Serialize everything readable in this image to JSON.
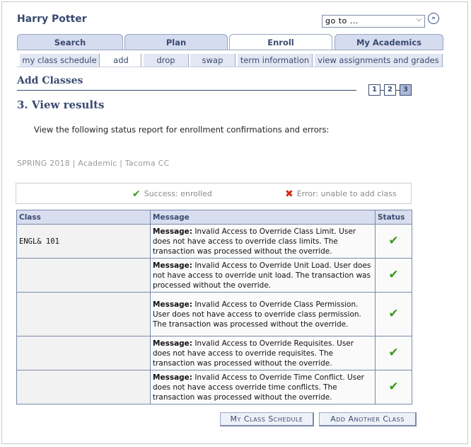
{
  "header": {
    "username": "Harry Potter",
    "goto_placeholder": "go to ...",
    "goto_arrow": "⌵",
    "go_button_icon": "»"
  },
  "tabs": [
    {
      "label": "Search"
    },
    {
      "label": "Plan"
    },
    {
      "label": "Enroll",
      "active": true
    },
    {
      "label": "My Academics"
    }
  ],
  "subtabs": [
    {
      "label": "my class schedule"
    },
    {
      "label": "add",
      "active": true
    },
    {
      "label": "drop"
    },
    {
      "label": "swap"
    },
    {
      "label": "term information"
    },
    {
      "label": "view assignments and grades"
    }
  ],
  "section": {
    "title": "Add Classes",
    "steps": [
      "1",
      "2",
      "3"
    ],
    "active_step": "3",
    "step_title": "3.  View results",
    "instructions": "View the following status report for enrollment confirmations and errors:",
    "term": "SPRING 2018 | Academic | Tacoma CC"
  },
  "legend": {
    "success_icon": "✔",
    "success_label": "Success: enrolled",
    "error_icon": "✖",
    "error_label": "Error: unable to add class"
  },
  "table": {
    "headers": {
      "class": "Class",
      "message": "Message",
      "status": "Status"
    },
    "rows": [
      {
        "class": "ENGL& 101",
        "prefix": "Message:",
        "message": " Invalid Access to Override Class Limit. User does not have access to override class limits. The transaction was processed without the override.",
        "status": "✔"
      },
      {
        "class": "",
        "prefix": "Message:",
        "message": " Invalid Access to Override Unit Load. User does not have access to override unit load. The transaction was processed without the override.",
        "status": "✔"
      },
      {
        "class": "",
        "prefix": "Message:",
        "message": " Invalid Access to Override Class Permission. User does not have access to override class permission. The transaction was processed without the override.",
        "status": "✔"
      },
      {
        "class": "",
        "prefix": "Message:",
        "message": " Invalid Access to Override Requisites. User does not have access to override requisites. The transaction was processed without the override.",
        "status": "✔"
      },
      {
        "class": "",
        "prefix": "Message:",
        "message": " Invalid Access to Override Time Conflict. User does not have access override time conflicts. The transaction was processed without the override.",
        "status": "✔"
      }
    ]
  },
  "buttons": {
    "my_schedule": "My Class Schedule",
    "add_another": "Add Another Class"
  },
  "colors": {
    "accent": "#3a4a70",
    "tab_bg": "#d6dcef",
    "success": "#3a9a1c",
    "error": "#d02c10"
  }
}
